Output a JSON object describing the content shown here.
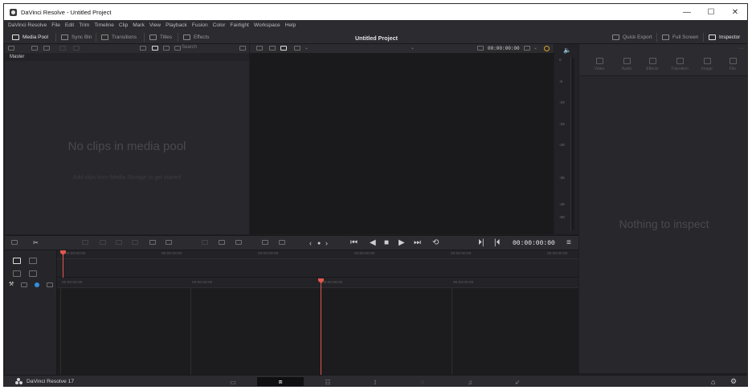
{
  "window": {
    "title": "DaVinci Resolve - Untitled Project",
    "controls": [
      "—",
      "☐",
      "✕"
    ]
  },
  "menu": [
    "DaVinci Resolve",
    "File",
    "Edit",
    "Trim",
    "Timeline",
    "Clip",
    "Mark",
    "View",
    "Playback",
    "Fusion",
    "Color",
    "Fairlight",
    "Workspace",
    "Help"
  ],
  "toolbar": {
    "media_pool": "Media Pool",
    "sync_bin": "Sync Bin",
    "transitions": "Transitions",
    "titles": "Titles",
    "effects": "Effects",
    "project_title": "Untitled Project",
    "quick_export": "Quick Export",
    "full_screen": "Full Screen",
    "inspector": "Inspector"
  },
  "media_pool": {
    "search_placeholder": "Search",
    "bin": "Master",
    "empty_title": "No clips in media pool",
    "empty_hint": "Add clips from Media Storage to get started"
  },
  "viewer": {
    "timecode_top": "00:00:00:00",
    "timecode": "00:00:00:00"
  },
  "meters": {
    "labels": [
      "0",
      "-5",
      "-10",
      "-15",
      "-20",
      "-30",
      "-40",
      "-50"
    ]
  },
  "inspector": {
    "tabs": [
      "Video",
      "Audio",
      "Effects",
      "Transition",
      "Image",
      "File"
    ],
    "empty": "Nothing to inspect"
  },
  "timeline": {
    "upper_ruler": [
      "00:00:00:00",
      "00:00:00:00",
      "00:00:00:00",
      "00:00:00:00",
      "00:00:00:00",
      "00:00:00:00"
    ],
    "lower_ruler": [
      "00:00:00:00",
      "00:00:00:00",
      "00:00:00:00",
      "00:00:00:00"
    ]
  },
  "pagebar": {
    "product": "DaVinci Resolve 17",
    "pages": [
      "media",
      "cut",
      "edit",
      "fusion",
      "color",
      "fairlight",
      "deliver"
    ],
    "active_page": "cut"
  }
}
